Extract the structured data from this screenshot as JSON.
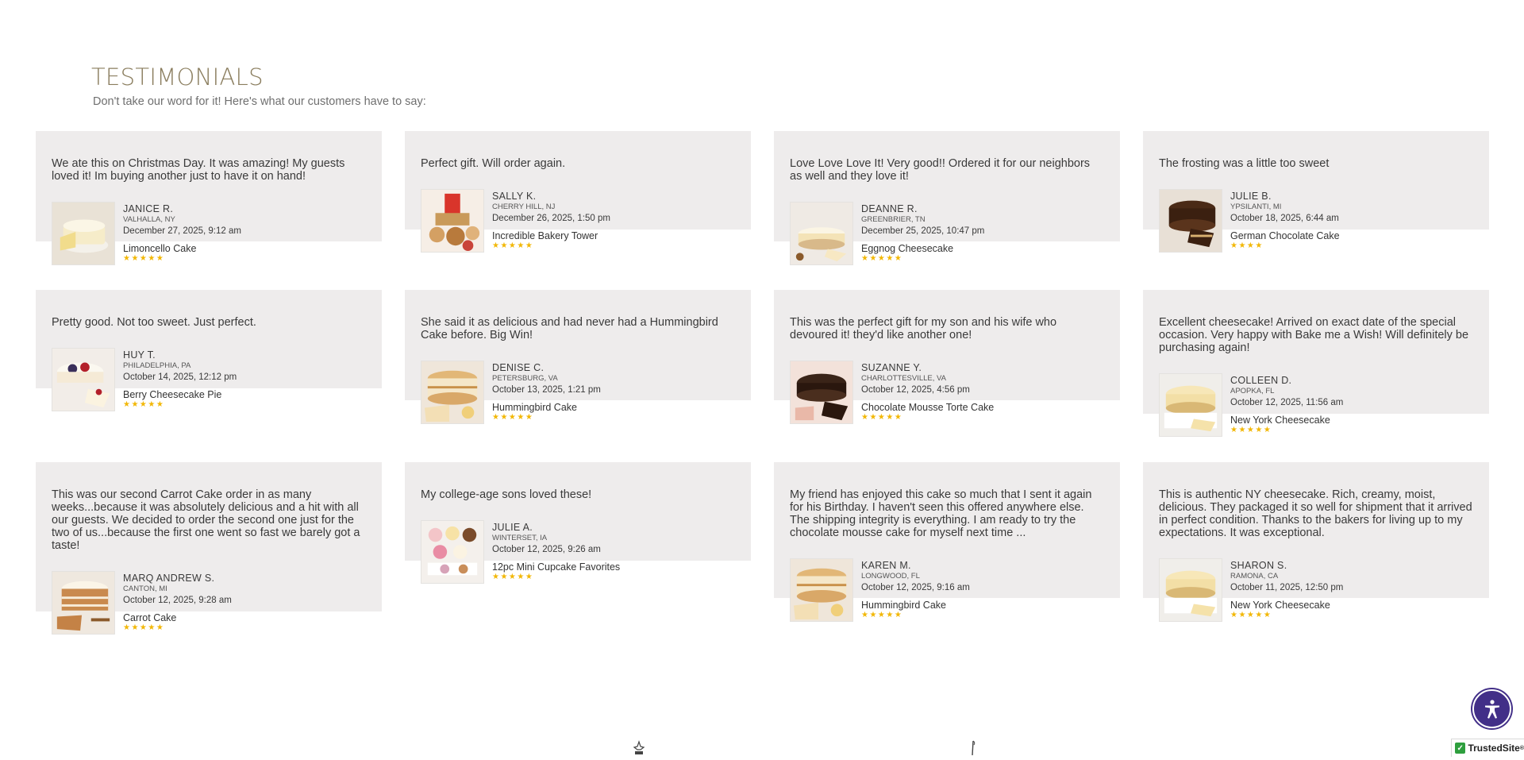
{
  "section": {
    "title": "TESTIMONIALS",
    "subtitle": "Don't take our word for it! Here's what our customers have to say:"
  },
  "testimonials": [
    {
      "quote": "We ate this on Christmas Day. It was amazing! My guests loved it! Im buying another just to have it on hand!",
      "name": "JANICE R.",
      "location": "VALHALLA, NY",
      "date": "December 27, 2025, 9:12 am",
      "product": "Limoncello Cake",
      "stars": "★★★★★",
      "image_icon": "limoncello-cake-image"
    },
    {
      "quote": "Perfect gift. Will order again.",
      "name": "SALLY K.",
      "location": "CHERRY HILL, NJ",
      "date": "December 26, 2025, 1:50 pm",
      "product": "Incredible Bakery Tower",
      "stars": "★★★★★",
      "image_icon": "bakery-tower-image"
    },
    {
      "quote": "Love Love Love It! Very good!! Ordered it for our neighbors as well and they love it!",
      "name": "DEANNE R.",
      "location": "GREENBRIER, TN",
      "date": "December 25, 2025, 10:47 pm",
      "product": "Eggnog Cheesecake",
      "stars": "★★★★★",
      "image_icon": "eggnog-cheesecake-image"
    },
    {
      "quote": "The frosting was a little too sweet",
      "name": "JULIE B.",
      "location": "YPSILANTI, MI",
      "date": "October 18, 2025, 6:44 am",
      "product": "German Chocolate Cake",
      "stars": "★★★★",
      "image_icon": "german-chocolate-cake-image"
    },
    {
      "quote": "Pretty good. Not too sweet. Just perfect.",
      "name": "HUY T.",
      "location": "PHILADELPHIA, PA",
      "date": "October 14, 2025, 12:12 pm",
      "product": "Berry Cheesecake Pie",
      "stars": "★★★★★",
      "image_icon": "berry-cheesecake-pie-image"
    },
    {
      "quote": "She said it as delicious and had never had a Hummingbird Cake before. Big Win!",
      "name": "DENISE C.",
      "location": "PETERSBURG, VA",
      "date": "October 13, 2025, 1:21 pm",
      "product": "Hummingbird Cake",
      "stars": "★★★★★",
      "image_icon": "hummingbird-cake-image"
    },
    {
      "quote": "This was the perfect gift for my son and his wife who devoured it! they'd like another one!",
      "name": "SUZANNE Y.",
      "location": "CHARLOTTESVILLE, VA",
      "date": "October 12, 2025, 4:56 pm",
      "product": "Chocolate Mousse Torte Cake",
      "stars": "★★★★★",
      "image_icon": "chocolate-mousse-torte-image"
    },
    {
      "quote": "Excellent cheesecake! Arrived on exact date of the special occasion. Very happy with Bake me a Wish! Will definitely be purchasing again!",
      "name": "COLLEEN D.",
      "location": "APOPKA, FL",
      "date": "October 12, 2025, 11:56 am",
      "product": "New York Cheesecake",
      "stars": "★★★★★",
      "image_icon": "new-york-cheesecake-image"
    },
    {
      "quote": "This was our second Carrot Cake order in as many weeks...because it was absolutely delicious and a hit with all our guests. We decided to order the second one just for the two of us...because the first one went so fast we barely got a taste!",
      "name": "MARQ ANDREW S.",
      "location": "CANTON, MI",
      "date": "October 12, 2025, 9:28 am",
      "product": "Carrot Cake",
      "stars": "★★★★★",
      "image_icon": "carrot-cake-image"
    },
    {
      "quote": "My college-age sons loved these!",
      "name": "JULIE A.",
      "location": "WINTERSET, IA",
      "date": "October 12, 2025, 9:26 am",
      "product": "12pc Mini Cupcake Favorites",
      "stars": "★★★★★",
      "image_icon": "mini-cupcakes-image"
    },
    {
      "quote": "My friend has enjoyed this cake so much that I sent it again for his Birthday. I haven't seen this offered anywhere else. The shipping integrity is everything. I am ready to try the chocolate mousse cake for myself next time ...",
      "name": "KAREN M.",
      "location": "LONGWOOD, FL",
      "date": "October 12, 2025, 9:16 am",
      "product": "Hummingbird Cake",
      "stars": "★★★★★",
      "image_icon": "hummingbird-cake-image"
    },
    {
      "quote": "This is authentic NY cheesecake. Rich, creamy, moist, delicious. They packaged it so well for shipment that it arrived in perfect condition. Thanks to the bakers for living up to my expectations. It was exceptional.",
      "name": "SHARON S.",
      "location": "RAMONA, CA",
      "date": "October 11, 2025, 12:50 pm",
      "product": "New York Cheesecake",
      "stars": "★★★★★",
      "image_icon": "new-york-cheesecake-image"
    }
  ],
  "badges": {
    "accessibility_icon": "accessibility-icon",
    "trusted_site_label": "TrustedSite",
    "trusted_site_mark": "®"
  },
  "colors": {
    "title": "#8a7d5e",
    "card_bg": "#eeecec",
    "stars": "#f2b705",
    "accessibility": "#422f88",
    "trusted_check": "#2e9f3e"
  }
}
